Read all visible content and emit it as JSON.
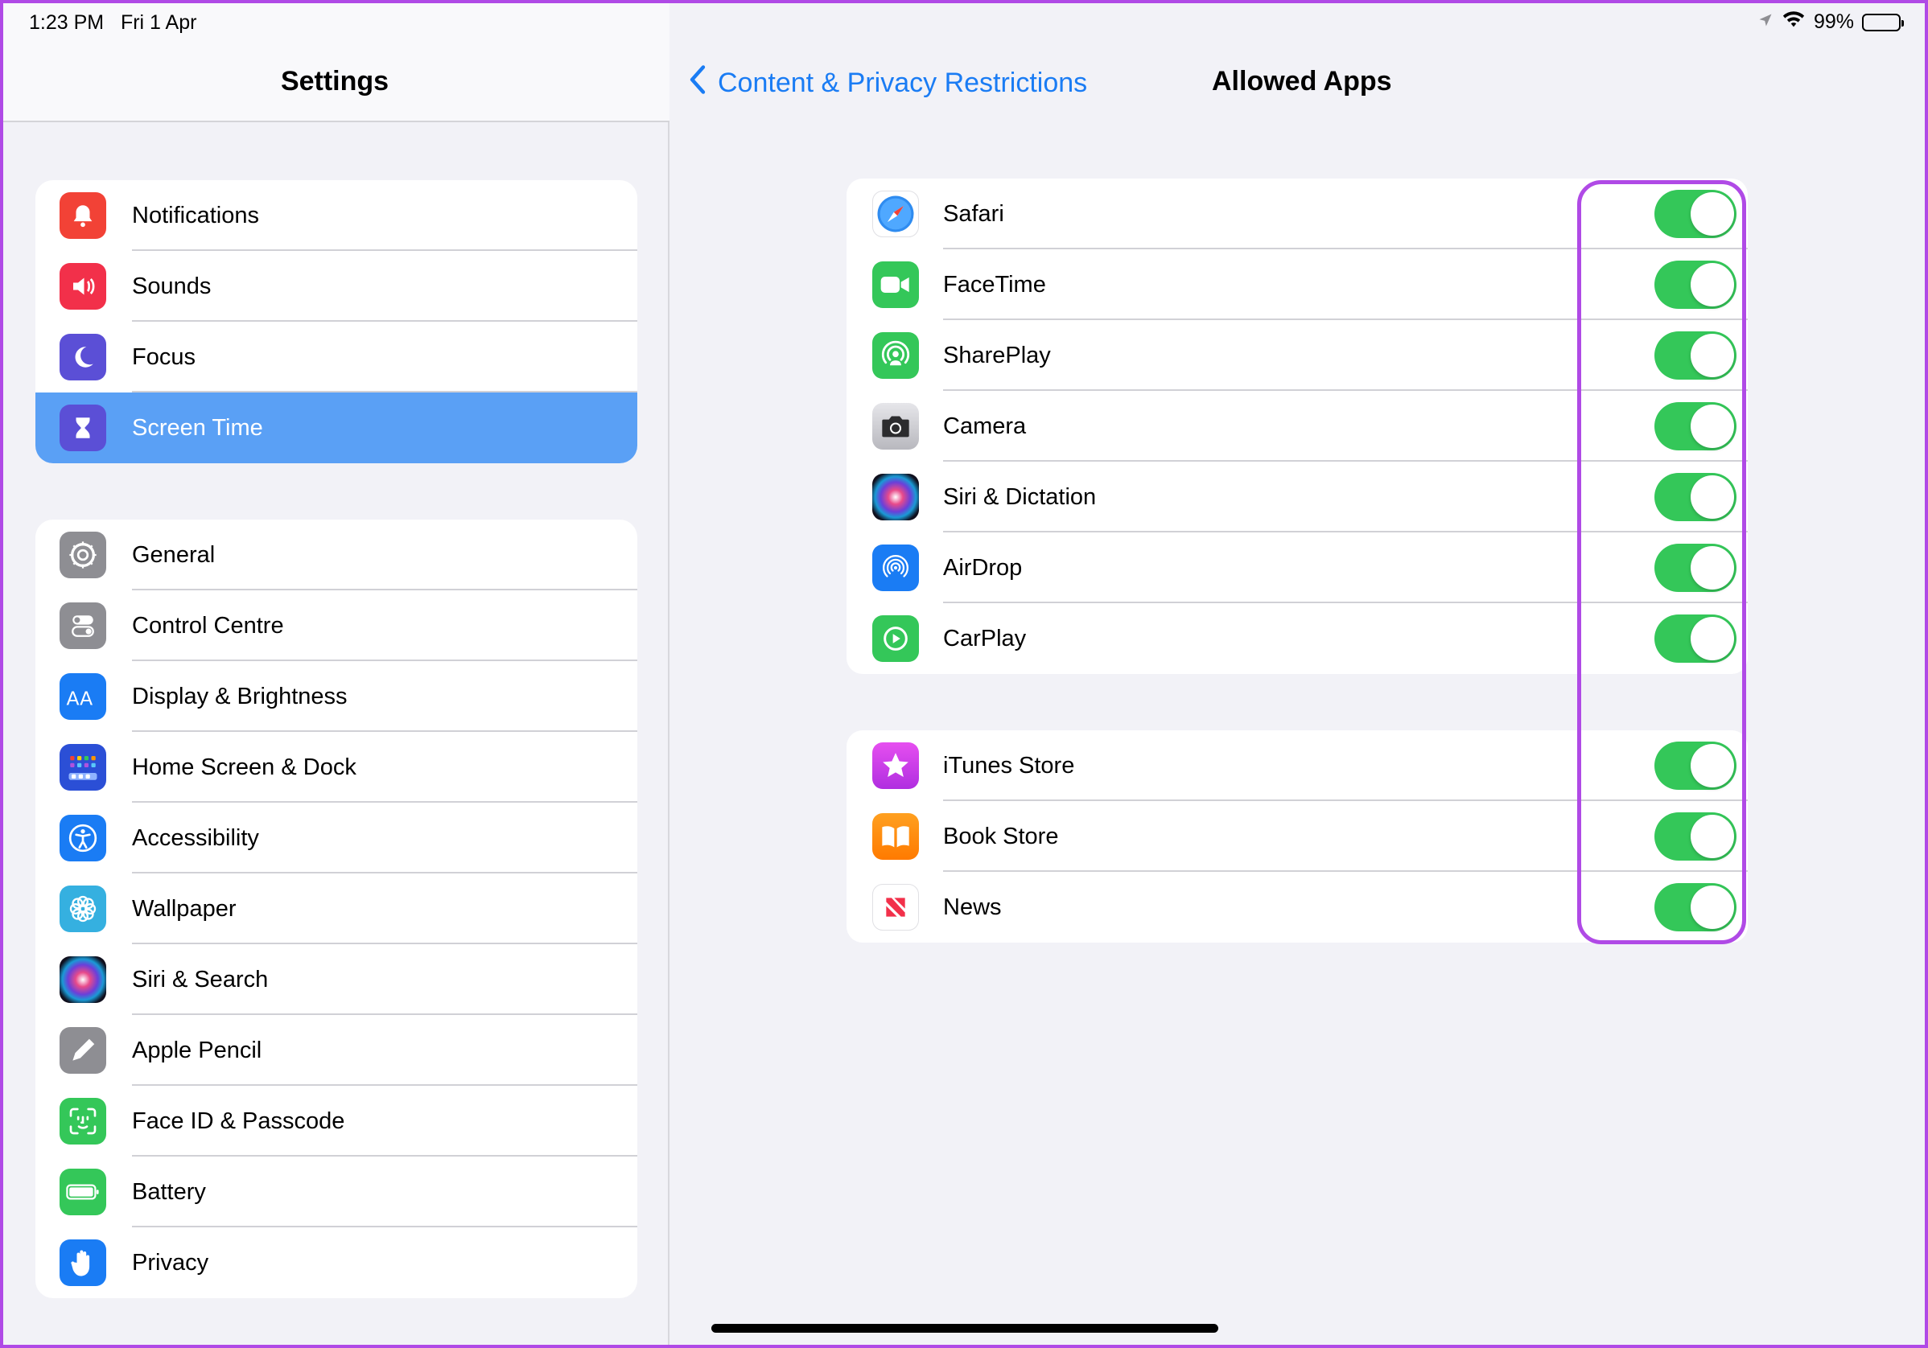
{
  "status": {
    "time": "1:23 PM",
    "date": "Fri 1 Apr",
    "battery": "99%"
  },
  "sidebar": {
    "title": "Settings",
    "group1": [
      {
        "label": "Notifications",
        "icon": "bell-icon",
        "color": "#f24236"
      },
      {
        "label": "Sounds",
        "icon": "speaker-icon",
        "color": "#f2304a"
      },
      {
        "label": "Focus",
        "icon": "moon-icon",
        "color": "#5b4fd6"
      },
      {
        "label": "Screen Time",
        "icon": "hourglass-icon",
        "color": "#5b4fd6",
        "selected": true
      }
    ],
    "group2": [
      {
        "label": "General",
        "icon": "gear-icon",
        "color": "#8e8e93"
      },
      {
        "label": "Control Centre",
        "icon": "switches-icon",
        "color": "#8e8e93"
      },
      {
        "label": "Display & Brightness",
        "icon": "text-size-icon",
        "color": "#1a7cf4"
      },
      {
        "label": "Home Screen & Dock",
        "icon": "grid-icon",
        "color": "#2b4fd6"
      },
      {
        "label": "Accessibility",
        "icon": "accessibility-icon",
        "color": "#1a7cf4"
      },
      {
        "label": "Wallpaper",
        "icon": "flower-icon",
        "color": "#35b0e0"
      },
      {
        "label": "Siri & Search",
        "icon": "siri-icon",
        "color": "#1c1c2e"
      },
      {
        "label": "Apple Pencil",
        "icon": "pencil-icon",
        "color": "#8e8e93"
      },
      {
        "label": "Face ID & Passcode",
        "icon": "faceid-icon",
        "color": "#34c759"
      },
      {
        "label": "Battery",
        "icon": "battery-icon",
        "color": "#34c759"
      },
      {
        "label": "Privacy",
        "icon": "hand-icon",
        "color": "#1a7cf4"
      }
    ]
  },
  "nav": {
    "back_label": "Content & Privacy Restrictions",
    "title": "Allowed Apps"
  },
  "apps_group1": [
    {
      "label": "Safari",
      "icon": "safari-icon",
      "color": "#2f8cf0",
      "on": true
    },
    {
      "label": "FaceTime",
      "icon": "video-icon",
      "color": "#34c759",
      "on": true
    },
    {
      "label": "SharePlay",
      "icon": "shareplay-icon",
      "color": "#34c759",
      "on": true
    },
    {
      "label": "Camera",
      "icon": "camera-icon",
      "color": "#d0d0d4",
      "on": true
    },
    {
      "label": "Siri & Dictation",
      "icon": "siri-icon",
      "color": "#1c1c2e",
      "on": true
    },
    {
      "label": "AirDrop",
      "icon": "airdrop-icon",
      "color": "#1a7cf4",
      "on": true
    },
    {
      "label": "CarPlay",
      "icon": "carplay-icon",
      "color": "#34c759",
      "on": true
    }
  ],
  "apps_group2": [
    {
      "label": "iTunes Store",
      "icon": "star-icon",
      "color": "#d63ee8",
      "on": true
    },
    {
      "label": "Book Store",
      "icon": "book-icon",
      "color": "#ff8a00",
      "on": true
    },
    {
      "label": "News",
      "icon": "news-icon",
      "color": "#ffffff",
      "on": true
    }
  ],
  "colors": {
    "accent": "#1a7cf4",
    "toggle_on": "#34c759",
    "selection": "#5aa0f5",
    "highlight": "#b04ae6"
  }
}
